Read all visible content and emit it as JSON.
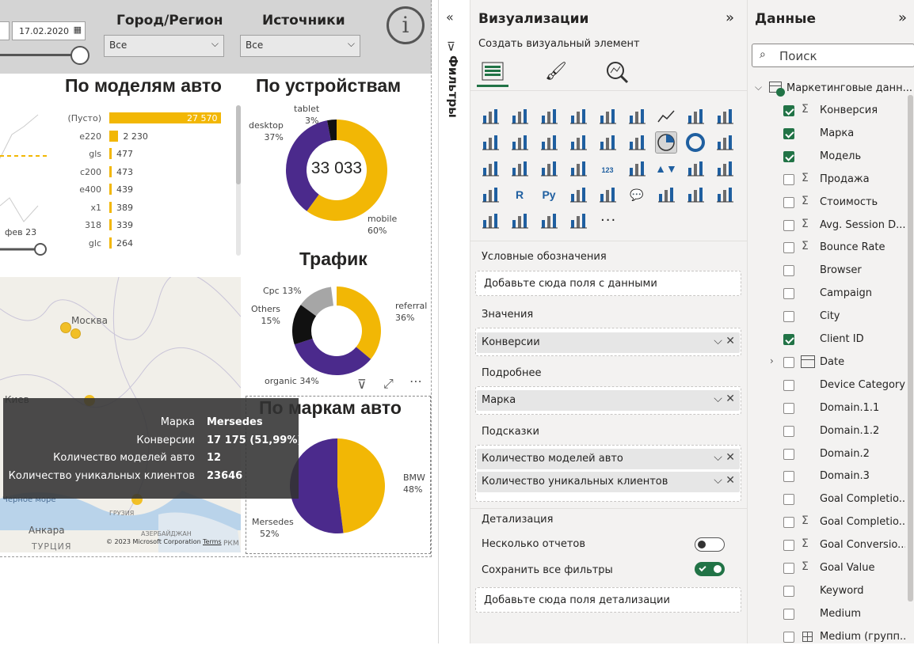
{
  "filters_bar": {
    "date_value": "17.02.2020",
    "city_label": "Город/Регион",
    "city_value": "Все",
    "source_label": "Источники",
    "source_value": "Все"
  },
  "models_chart": {
    "title": "По моделям авто",
    "categories": [
      "(Пусто)",
      "e220",
      "gls",
      "c200",
      "e400",
      "x1",
      "318",
      "glc"
    ],
    "value_labels": [
      "27 570",
      "2 230",
      "477",
      "473",
      "439",
      "389",
      "339",
      "264"
    ],
    "slider_label": "фев 23"
  },
  "devices_chart": {
    "title": "По устройствам",
    "center": "33 033",
    "labels": [
      {
        "name": "tablet",
        "pct": "3%"
      },
      {
        "name": "desktop",
        "pct": "37%"
      },
      {
        "name": "mobile",
        "pct": "60%"
      }
    ]
  },
  "traffic_chart": {
    "title": "Трафик",
    "labels": [
      {
        "name": "Cpc",
        "pct": "13%"
      },
      {
        "name": "Others",
        "pct": "15%"
      },
      {
        "name": "referral",
        "pct": "36%"
      },
      {
        "name": "organic",
        "pct": "34%"
      }
    ]
  },
  "brands_chart": {
    "title": "По маркам авто",
    "labels": [
      {
        "name": "BMW",
        "pct": "48%"
      },
      {
        "name": "Mersedes",
        "pct": "52%"
      }
    ]
  },
  "map": {
    "city_moscow": "Москва",
    "city_ankara": "Анкара",
    "country_turkey": "ТУРЦИЯ",
    "label_kiev": "Киев",
    "sea": "Черное море",
    "label_georgia": "ГРУЗИЯ",
    "label_azerbaijan": "АЗЕРБАЙДЖАН",
    "label_rkm": "РКМ",
    "copyright": "© 2023 Microsoft Corporation",
    "terms": "Terms"
  },
  "tooltip": {
    "rows": [
      {
        "k": "Марка",
        "v": "Mersedes"
      },
      {
        "k": "Конверсии",
        "v": "17 175 (51,99%)"
      },
      {
        "k": "Количество моделей авто",
        "v": "12"
      },
      {
        "k": "Количество уникальных клиентов",
        "v": "23646"
      }
    ]
  },
  "filters_pane": {
    "label": "Фильтры"
  },
  "viz_pane": {
    "title": "Визуализации",
    "subtitle": "Создать визуальный элемент",
    "more": "···",
    "sections": {
      "legend": "Условные обозначения",
      "legend_placeholder": "Добавьте сюда поля с данными",
      "values": "Значения",
      "values_field": "Конверсии",
      "details": "Подробнее",
      "details_field": "Марка",
      "tooltips": "Подсказки",
      "tooltip_field1": "Количество моделей авто",
      "tooltip_field2": "Количество уникальных клиентов",
      "drill": "Детализация",
      "cross_report": "Несколько отчетов",
      "keep_filters": "Сохранить все фильтры",
      "drill_placeholder": "Добавьте сюда поля детализации"
    }
  },
  "data_pane": {
    "title": "Данные",
    "search_placeholder": "Поиск",
    "table_name": "Маркетинговые данн...",
    "fields": [
      {
        "name": "Конверсия",
        "sigma": true,
        "checked": true
      },
      {
        "name": "Марка",
        "sigma": false,
        "checked": true
      },
      {
        "name": "Модель",
        "sigma": false,
        "checked": true
      },
      {
        "name": "Продажа",
        "sigma": true,
        "checked": false
      },
      {
        "name": "Стоимость",
        "sigma": true,
        "checked": false
      },
      {
        "name": "Avg. Session D...",
        "sigma": true,
        "checked": false
      },
      {
        "name": "Bounce Rate",
        "sigma": true,
        "checked": false
      },
      {
        "name": "Browser",
        "sigma": false,
        "checked": false
      },
      {
        "name": "Campaign",
        "sigma": false,
        "checked": false
      },
      {
        "name": "City",
        "sigma": false,
        "checked": false
      },
      {
        "name": "Client ID",
        "sigma": false,
        "checked": true
      },
      {
        "name": "Date",
        "sigma": false,
        "checked": false,
        "date": true
      },
      {
        "name": "Device Category",
        "sigma": false,
        "checked": false
      },
      {
        "name": "Domain.1.1",
        "sigma": false,
        "checked": false
      },
      {
        "name": "Domain.1.2",
        "sigma": false,
        "checked": false
      },
      {
        "name": "Domain.2",
        "sigma": false,
        "checked": false
      },
      {
        "name": "Domain.3",
        "sigma": false,
        "checked": false
      },
      {
        "name": "Goal Completio...",
        "sigma": false,
        "checked": false
      },
      {
        "name": "Goal Completio...",
        "sigma": true,
        "checked": false
      },
      {
        "name": "Goal Conversio...",
        "sigma": true,
        "checked": false
      },
      {
        "name": "Goal Value",
        "sigma": true,
        "checked": false
      },
      {
        "name": "Keyword",
        "sigma": false,
        "checked": false
      },
      {
        "name": "Medium",
        "sigma": false,
        "checked": false
      },
      {
        "name": "Medium (групп...",
        "sigma": false,
        "checked": false,
        "group": true
      }
    ]
  },
  "colors": {
    "accent": "#F2B705",
    "purple": "#4B2A8C",
    "black": "#111111",
    "gray": "#A6A6A6",
    "check": "#217346"
  }
}
